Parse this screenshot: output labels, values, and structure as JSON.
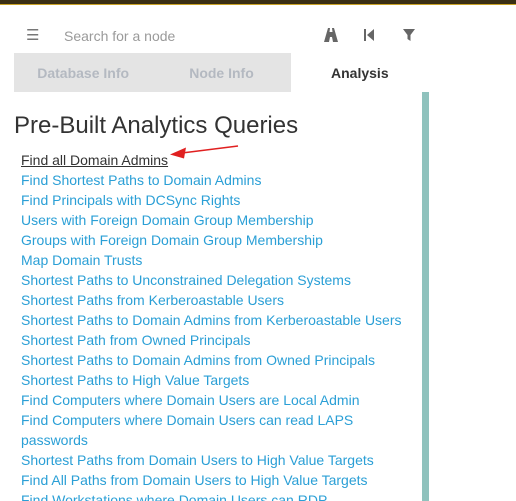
{
  "search": {
    "placeholder": "Search for a node"
  },
  "toolbar": {
    "icons": [
      "menu-icon",
      "pathfinding-icon",
      "back-icon",
      "filter-icon"
    ]
  },
  "tabs": [
    {
      "label": "Database Info",
      "active": false
    },
    {
      "label": "Node Info",
      "active": false
    },
    {
      "label": "Analysis",
      "active": true
    }
  ],
  "analysis": {
    "heading": "Pre-Built Analytics Queries",
    "queries": [
      "Find all Domain Admins",
      "Find Shortest Paths to Domain Admins",
      "Find Principals with DCSync Rights",
      "Users with Foreign Domain Group Membership",
      "Groups with Foreign Domain Group Membership",
      "Map Domain Trusts",
      "Shortest Paths to Unconstrained Delegation Systems",
      "Shortest Paths from Kerberoastable Users",
      "Shortest Paths to Domain Admins from Kerberoastable Users",
      "Shortest Path from Owned Principals",
      "Shortest Paths to Domain Admins from Owned Principals",
      "Shortest Paths to High Value Targets",
      "Find Computers where Domain Users are Local Admin",
      "Find Computers where Domain Users can read LAPS passwords",
      "Shortest Paths from Domain Users to High Value Targets",
      "Find All Paths from Domain Users to High Value Targets",
      "Find Workstations where Domain Users can RDP"
    ]
  },
  "colors": {
    "link": "#2a9fd6",
    "annotation_arrow": "#e02020",
    "scrollbar": "#8fc2bd",
    "tab_inactive_bg": "#e4e4e4"
  }
}
